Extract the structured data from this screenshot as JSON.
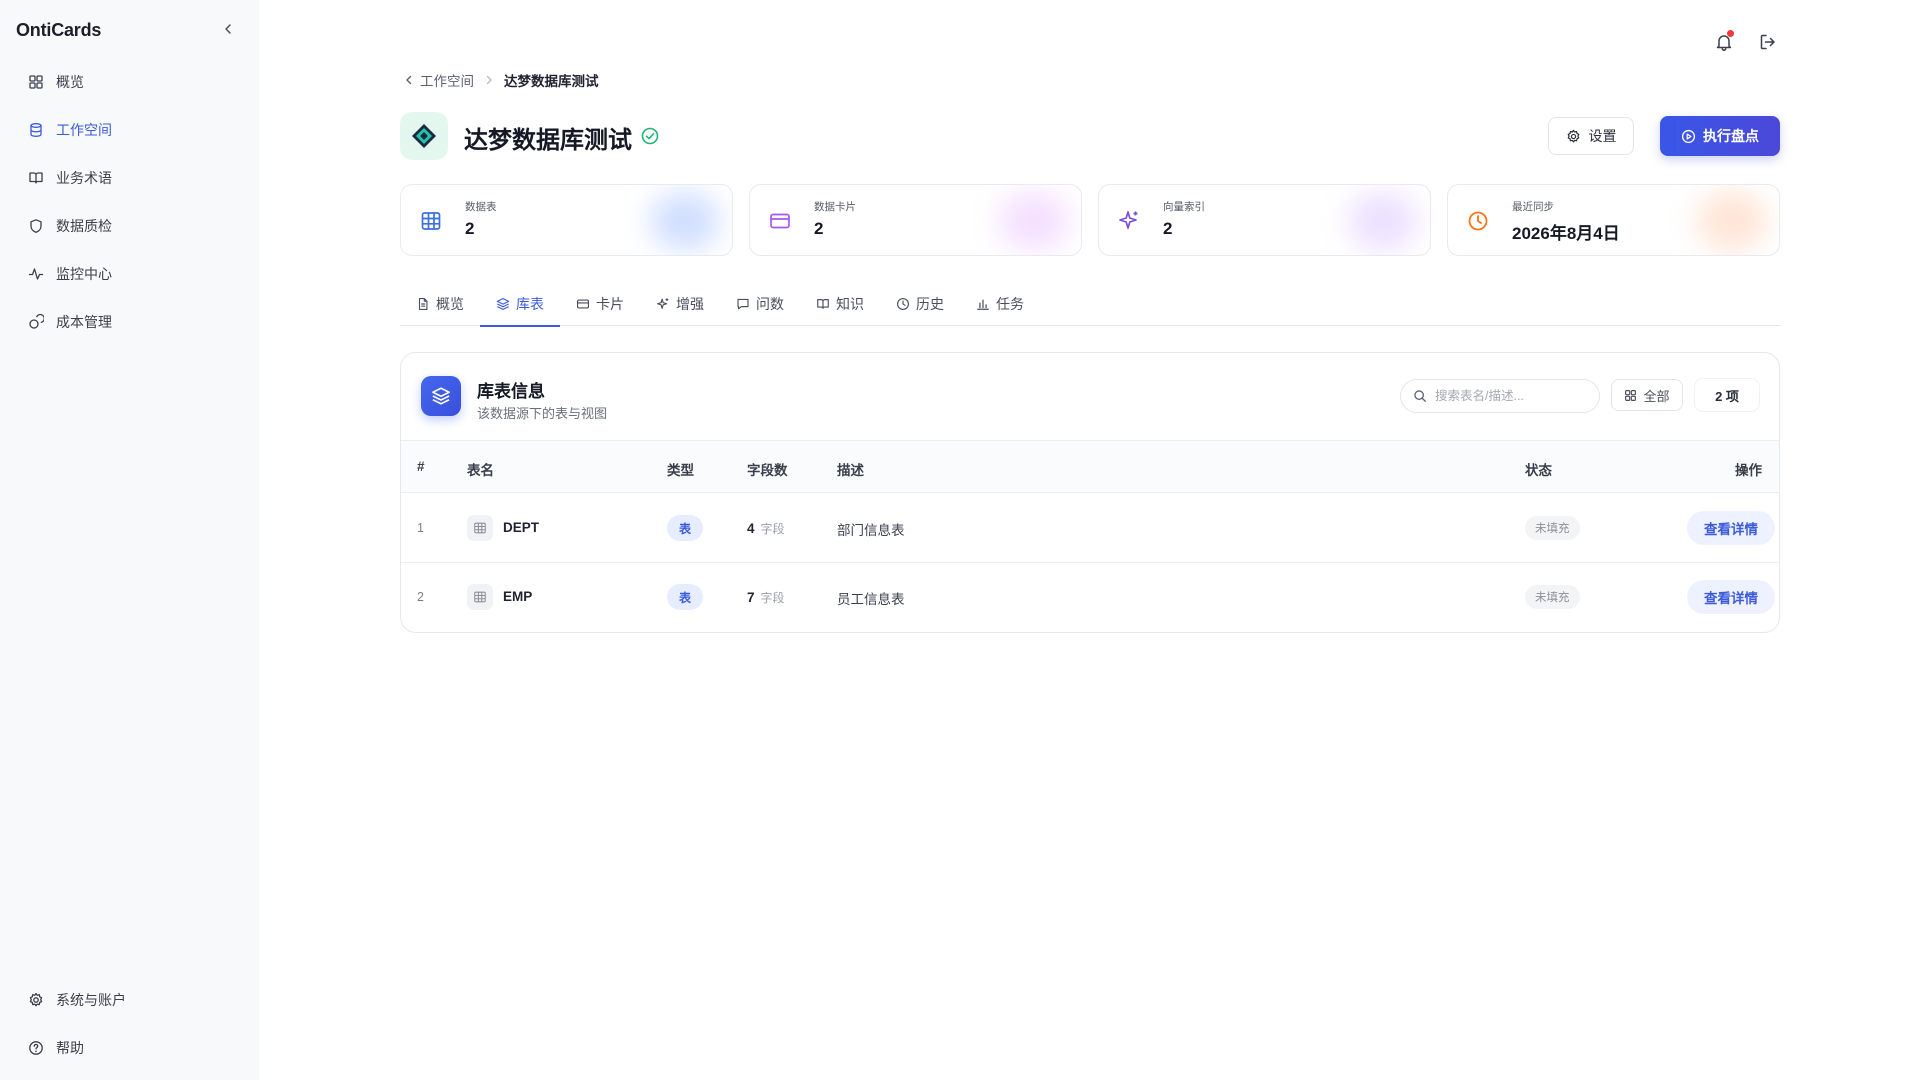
{
  "app": {
    "brand": "OntiCards"
  },
  "sidebar": {
    "items": [
      {
        "label": "概览",
        "icon": "grid-icon"
      },
      {
        "label": "工作空间",
        "icon": "database-icon",
        "active": true
      },
      {
        "label": "业务术语",
        "icon": "book-icon"
      },
      {
        "label": "数据质检",
        "icon": "shield-icon"
      },
      {
        "label": "监控中心",
        "icon": "activity-icon"
      },
      {
        "label": "成本管理",
        "icon": "coins-icon"
      }
    ],
    "bottom": [
      {
        "label": "系统与账户",
        "icon": "gear-icon"
      },
      {
        "label": "帮助",
        "icon": "help-circle-icon"
      }
    ]
  },
  "breadcrumb": {
    "parent": "工作空间",
    "current": "达梦数据库测试"
  },
  "header": {
    "title": "达梦数据库测试",
    "settings_label": "设置",
    "run_label": "执行盘点"
  },
  "stats": [
    {
      "label": "数据表",
      "value": "2",
      "icon": "table-icon",
      "color": "#3b6fe0"
    },
    {
      "label": "数据卡片",
      "value": "2",
      "icon": "card-icon",
      "color": "#a855f7"
    },
    {
      "label": "向量索引",
      "value": "2",
      "icon": "sparkles-icon",
      "color": "#7c4ddb"
    },
    {
      "label": "最近同步",
      "value": "2026年8月4日",
      "icon": "clock-icon",
      "color": "#f97316"
    }
  ],
  "tabs": [
    {
      "label": "概览",
      "icon": "file-icon"
    },
    {
      "label": "库表",
      "icon": "layers-icon",
      "active": true
    },
    {
      "label": "卡片",
      "icon": "card-icon"
    },
    {
      "label": "增强",
      "icon": "sparkles-icon"
    },
    {
      "label": "问数",
      "icon": "message-icon"
    },
    {
      "label": "知识",
      "icon": "book-icon"
    },
    {
      "label": "历史",
      "icon": "clock-icon"
    },
    {
      "label": "任务",
      "icon": "bar-chart-icon"
    }
  ],
  "panel": {
    "title": "库表信息",
    "subtitle": "该数据源下的表与视图",
    "search_placeholder": "搜索表名/描述...",
    "filter_label": "全部",
    "count_label": "2 项"
  },
  "table": {
    "columns": [
      "#",
      "表名",
      "类型",
      "字段数",
      "描述",
      "状态",
      "操作"
    ],
    "rows": [
      {
        "index": "1",
        "name": "DEPT",
        "type": "表",
        "fields": "4",
        "field_unit": "字段",
        "desc": "部门信息表",
        "status": "未填充",
        "action": "查看详情"
      },
      {
        "index": "2",
        "name": "EMP",
        "type": "表",
        "fields": "7",
        "field_unit": "字段",
        "desc": "员工信息表",
        "status": "未填充",
        "action": "查看详情"
      }
    ]
  }
}
